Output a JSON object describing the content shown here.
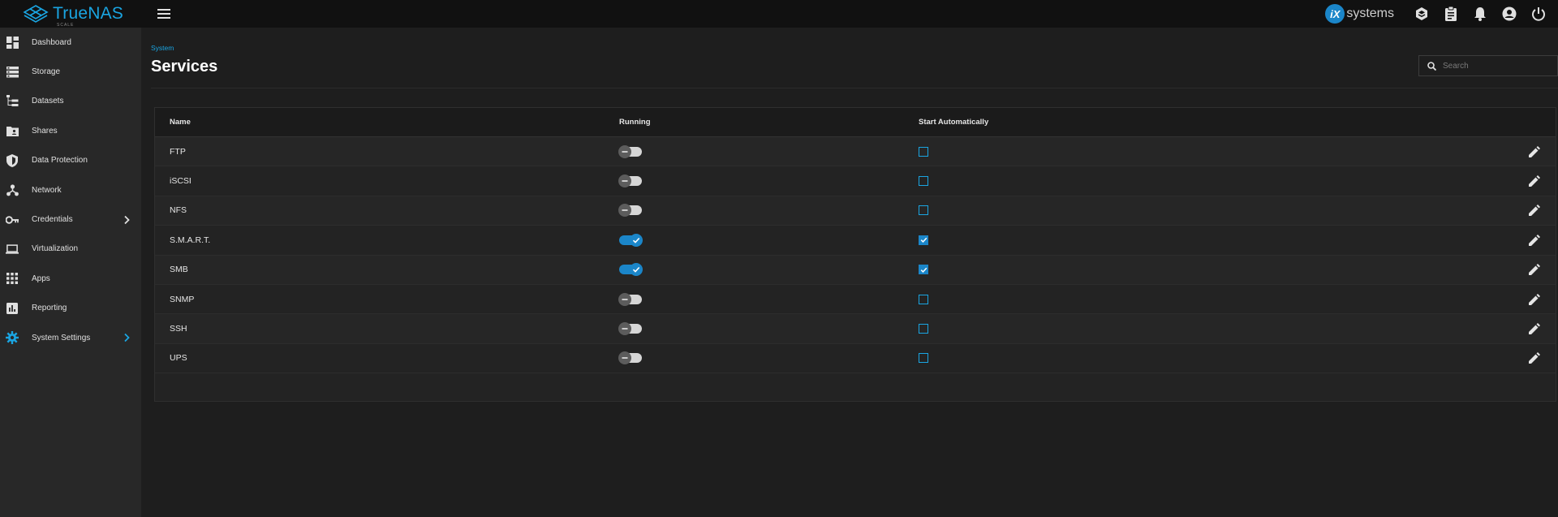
{
  "brand": {
    "name": "TrueNAS",
    "edition": "SCALE"
  },
  "header": {
    "vendor_badge": "iX",
    "vendor_text": "systems"
  },
  "sidebar": {
    "items": [
      {
        "label": "Dashboard",
        "icon": "dashboard-icon"
      },
      {
        "label": "Storage",
        "icon": "storage-icon"
      },
      {
        "label": "Datasets",
        "icon": "datasets-icon"
      },
      {
        "label": "Shares",
        "icon": "shares-icon"
      },
      {
        "label": "Data Protection",
        "icon": "shield-icon"
      },
      {
        "label": "Network",
        "icon": "network-icon"
      },
      {
        "label": "Credentials",
        "icon": "key-icon"
      },
      {
        "label": "Virtualization",
        "icon": "laptop-icon"
      },
      {
        "label": "Apps",
        "icon": "apps-grid-icon"
      },
      {
        "label": "Reporting",
        "icon": "bar-chart-icon"
      },
      {
        "label": "System Settings",
        "icon": "gear-icon"
      }
    ]
  },
  "page": {
    "breadcrumb": "System",
    "title": "Services",
    "search_placeholder": "Search"
  },
  "table": {
    "columns": [
      "Name",
      "Running",
      "Start Automatically"
    ],
    "rows": [
      {
        "name": "FTP",
        "running": false,
        "auto_start": false
      },
      {
        "name": "iSCSI",
        "running": false,
        "auto_start": false
      },
      {
        "name": "NFS",
        "running": false,
        "auto_start": false
      },
      {
        "name": "S.M.A.R.T.",
        "running": true,
        "auto_start": true
      },
      {
        "name": "SMB",
        "running": true,
        "auto_start": true
      },
      {
        "name": "SNMP",
        "running": false,
        "auto_start": false
      },
      {
        "name": "SSH",
        "running": false,
        "auto_start": false
      },
      {
        "name": "UPS",
        "running": false,
        "auto_start": false
      }
    ]
  },
  "colors": {
    "accent": "#1aa5e2",
    "toggle_on": "#1b86c9",
    "background": "#1e1e1e",
    "sidebar": "#282828",
    "topbar": "#111111"
  }
}
